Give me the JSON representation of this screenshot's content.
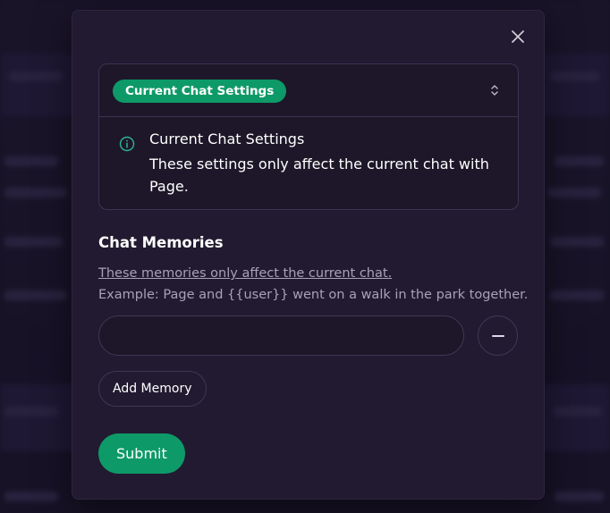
{
  "modal": {
    "close_icon": "close-icon",
    "settings": {
      "badge_label": "Current Chat Settings",
      "chevron_icon": "chevron-up-down-icon",
      "info_icon": "info-icon",
      "info_title": "Current Chat Settings",
      "info_description": "These settings only affect the current chat with Page."
    },
    "memories": {
      "title": "Chat Memories",
      "link_text": "These memories only affect the current chat.",
      "example_text": "Example: Page and {{user}} went on a walk in the park together.",
      "input_value": "",
      "input_placeholder": "",
      "remove_icon": "minus-icon",
      "add_button_label": "Add Memory"
    },
    "submit_label": "Submit"
  },
  "colors": {
    "accent": "#0e9a68",
    "info_icon": "#2fb598",
    "modal_bg": "#211a30",
    "muted_text": "#a8a2b8"
  }
}
